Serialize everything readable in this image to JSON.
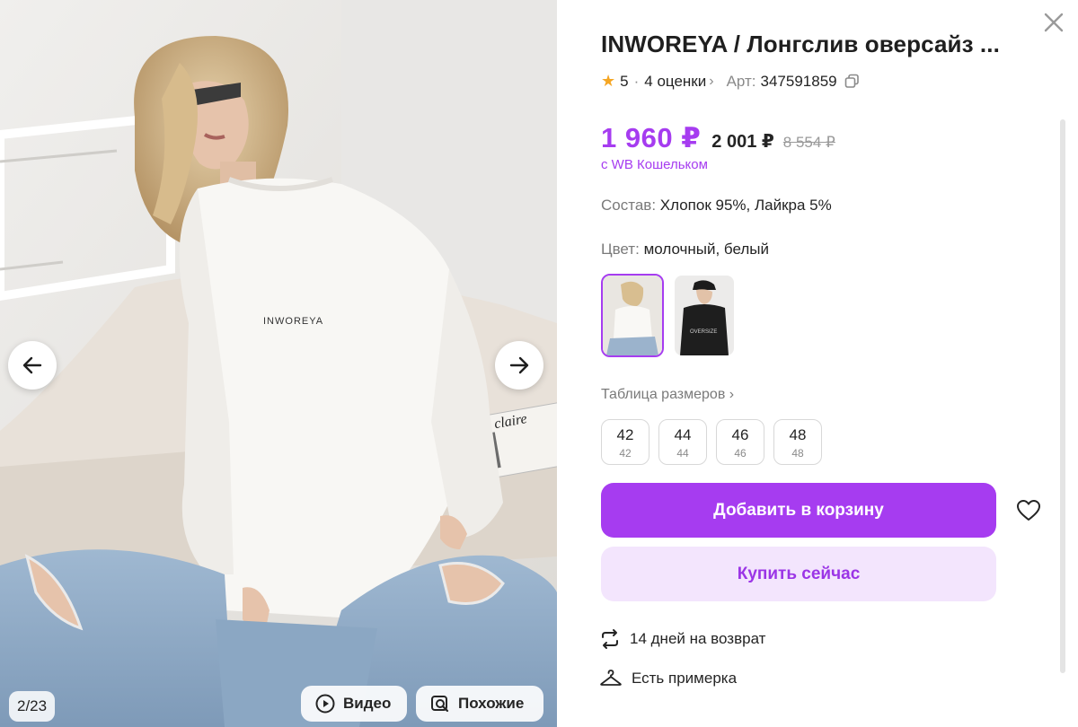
{
  "gallery": {
    "counter": "2/23",
    "video_label": "Видео",
    "similar_label": "Похожие",
    "print_text": "INWOREYA",
    "magazine_text": "Marie claire",
    "icons": [
      "arrow-left-icon",
      "arrow-right-icon",
      "play-icon",
      "similar-search-icon"
    ]
  },
  "product": {
    "title": "INWOREYA / Лонгслив оверсайз ...",
    "rating": "5",
    "reviews": "4 оценки",
    "article_label": "Арт:",
    "article": "347591859",
    "price_main": "1 960 ₽",
    "price_mid": "2 001 ₽",
    "price_old": "8 554 ₽",
    "wallet_note": "с WB Кошельком",
    "composition_label": "Состав:",
    "composition": "Хлопок 95%, Лайкра 5%",
    "color_label": "Цвет:",
    "color": "молочный, белый",
    "swatch_text": "OVERSIZE",
    "size_table_label": "Таблица размеров",
    "sizes": [
      {
        "ru": "42",
        "alt": "42"
      },
      {
        "ru": "44",
        "alt": "44"
      },
      {
        "ru": "46",
        "alt": "46"
      },
      {
        "ru": "48",
        "alt": "48"
      }
    ],
    "add_to_cart": "Добавить в корзину",
    "buy_now": "Купить сейчас",
    "returns": "14 дней на возврат",
    "fitting": "Есть примерка"
  },
  "colors": {
    "accent": "#a63cf0",
    "accent_light": "#f3e5fd",
    "star": "#f5a623"
  }
}
